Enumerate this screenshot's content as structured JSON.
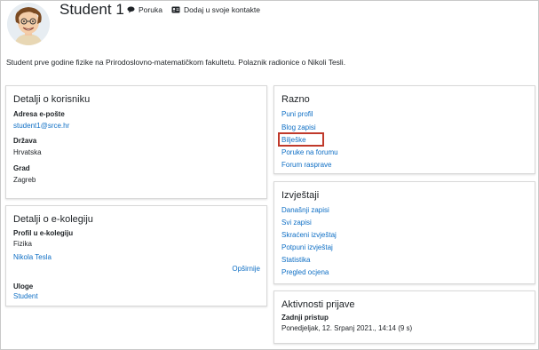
{
  "profile": {
    "name": "Student 1",
    "message_label": "Poruka",
    "add_contact_label": "Dodaj u svoje kontakte",
    "description": "Student prve godine fizike na Prirodoslovno-matematičkom fakultetu. Polaznik radionice o Nikoli Tesli."
  },
  "user_details": {
    "title": "Detalji o korisniku",
    "email_label": "Adresa e-pošte",
    "email": "student1@srce.hr",
    "country_label": "Država",
    "country": "Hrvatska",
    "city_label": "Grad",
    "city": "Zagreb"
  },
  "course_details": {
    "title": "Detalji o e-kolegiju",
    "profile_label": "Profil u e-kolegiju",
    "course_name": "Fizika",
    "course_link": "Nikola Tesla",
    "more_link": "Opširnije",
    "roles_label": "Uloge",
    "role": "Student"
  },
  "misc": {
    "title": "Razno",
    "links": [
      "Puni profil",
      "Blog zapisi",
      "Bilješke",
      "Poruke na forumu",
      "Forum rasprave"
    ]
  },
  "reports": {
    "title": "Izvještaji",
    "links": [
      "Današnji zapisi",
      "Svi zapisi",
      "Skraćeni izvještaj",
      "Potpuni izvještaj",
      "Statistika",
      "Pregled ocjena"
    ]
  },
  "login_activity": {
    "title": "Aktivnosti prijave",
    "last_access_label": "Zadnji pristup",
    "last_access": "Ponedjeljak, 12. Srpanj 2021., 14:14  (9 s)"
  },
  "colors": {
    "link": "#0f6fc5",
    "highlight": "#c0392b"
  },
  "icons": {
    "message": "speech-bubble-icon",
    "contact": "address-card-icon"
  }
}
